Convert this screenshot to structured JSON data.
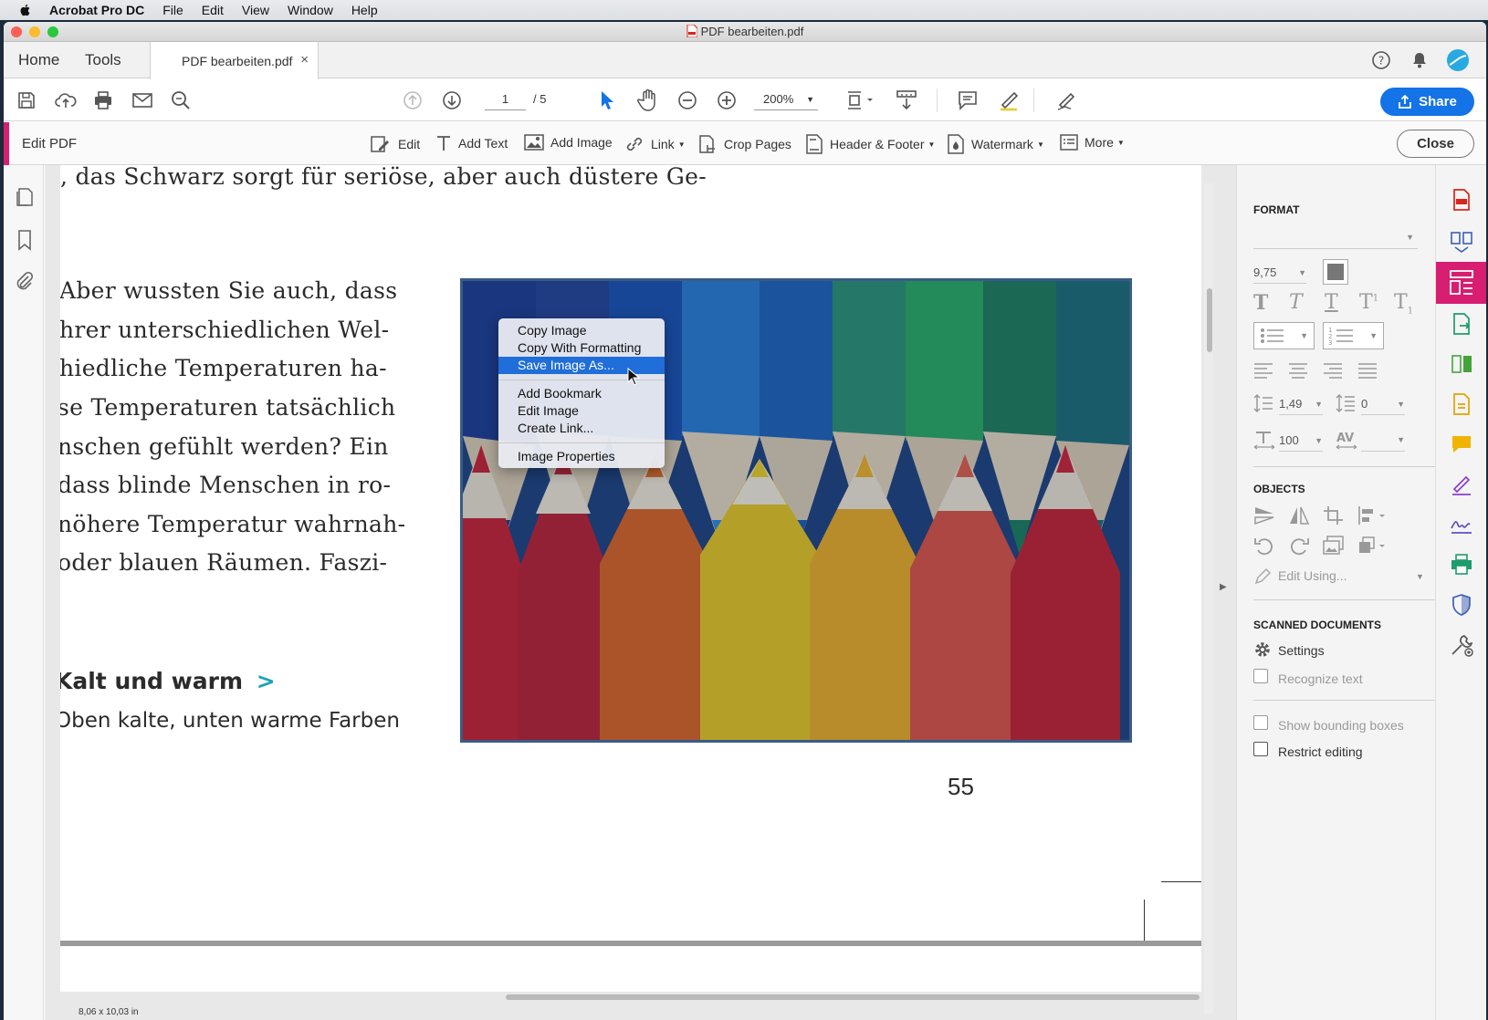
{
  "menubar": {
    "app": "Acrobat Pro DC",
    "items": [
      "File",
      "Edit",
      "View",
      "Window",
      "Help"
    ]
  },
  "window": {
    "title": "PDF bearbeiten.pdf"
  },
  "tabs": {
    "home": "Home",
    "tools": "Tools",
    "document": "PDF bearbeiten.pdf",
    "close_glyph": "×"
  },
  "toolbar": {
    "page_current": "1",
    "page_total": "/ 5",
    "zoom": "200%",
    "share_label": "Share"
  },
  "editbar": {
    "title": "Edit PDF",
    "tools": [
      "Edit",
      "Add Text",
      "Add Image",
      "Link",
      "Crop Pages",
      "Header & Footer",
      "Watermark",
      "More"
    ],
    "close_label": "Close"
  },
  "document": {
    "top_line": ", das Schwarz sorgt für seriöse, aber auch düstere Ge-",
    "paragraph": [
      "Aber wussten Sie auch, dass",
      "hrer unterschiedlichen Wel-",
      "hiedliche Temperaturen ha-",
      "se Temperaturen tatsächlich",
      "nschen gefühlt werden? Ein",
      " dass blinde Menschen in ro-",
      "nöhere Temperatur wahrnah-",
      " oder blauen Räumen. Faszi-"
    ],
    "heading": "Kalt und warm",
    "heading_arrow": ">",
    "subheading": "Oben kalte, unten warme Farben",
    "page_number": "55",
    "page_size": "8,06 x 10,03 in"
  },
  "context_menu": {
    "group1": [
      "Copy Image",
      "Copy With Formatting",
      "Save Image As..."
    ],
    "group2": [
      "Add Bookmark",
      "Edit Image",
      "Create Link..."
    ],
    "group3": [
      "Image Properties"
    ],
    "selected": "Save Image As..."
  },
  "right_panel": {
    "format_heading": "FORMAT",
    "font_size": "9,75",
    "line_spacing": "1,49",
    "paragraph_spacing": "0",
    "horizontal_scale": "100",
    "objects_heading": "OBJECTS",
    "edit_using": "Edit Using...",
    "scanned_heading": "SCANNED DOCUMENTS",
    "settings": "Settings",
    "recognize_text": "Recognize text",
    "show_bounding_boxes": "Show bounding boxes",
    "restrict_editing": "Restrict editing"
  },
  "colors": {
    "accent": "#d71e71",
    "share": "#1473e6",
    "menu_selection": "#1f6ed9",
    "link_arrow": "#1aa3b8"
  }
}
